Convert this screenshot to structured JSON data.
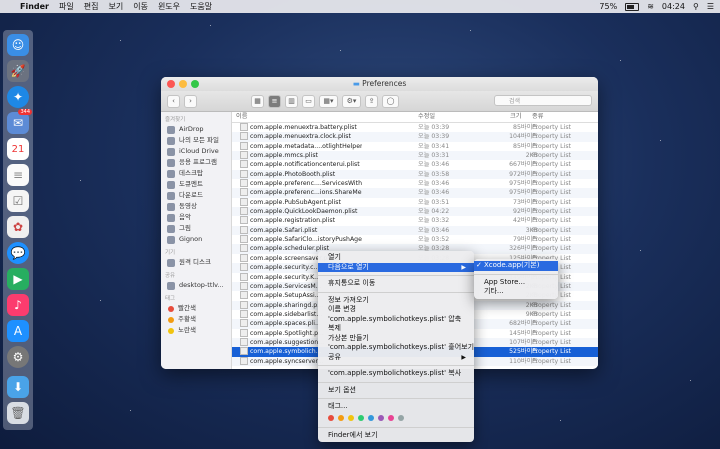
{
  "menubar": {
    "app": "Finder",
    "items": [
      "파일",
      "편집",
      "보기",
      "이동",
      "윈도우",
      "도움말"
    ],
    "battery": "75%",
    "clock": "04:24"
  },
  "window": {
    "title": "Preferences",
    "search_placeholder": "검색"
  },
  "sidebar": {
    "favorites_header": "즐겨찾기",
    "favorites": [
      "AirDrop",
      "나의 모든 파일",
      "iCloud Drive",
      "응용 프로그램",
      "데스크탑",
      "도큐멘트",
      "다운로드",
      "동영상",
      "음악",
      "그림",
      "Gignon"
    ],
    "devices_header": "기기",
    "devices": [
      "원격 디스크"
    ],
    "shared_header": "공유",
    "shared": [
      "desktop-ttlv..."
    ],
    "tags_header": "태그",
    "tags": [
      {
        "label": "빨간색",
        "color": "#e74c3c"
      },
      {
        "label": "주황색",
        "color": "#f39c12"
      },
      {
        "label": "노란색",
        "color": "#f1c40f"
      }
    ]
  },
  "list": {
    "headers": {
      "name": "이름",
      "date": "수정일",
      "size": "크기",
      "kind": "종류"
    },
    "rows": [
      {
        "name": "com.apple.menuextra.battery.plist",
        "date": "오늘 03:39",
        "size": "85바이트",
        "kind": "Property List"
      },
      {
        "name": "com.apple.menuextra.clock.plist",
        "date": "오늘 03:39",
        "size": "104바이트",
        "kind": "Property List"
      },
      {
        "name": "com.apple.metadata....otlightHelper.plist",
        "date": "오늘 03:41",
        "size": "85바이트",
        "kind": "Property List"
      },
      {
        "name": "com.apple.mmcs.plist",
        "date": "오늘 03:31",
        "size": "2KB",
        "kind": "Property List"
      },
      {
        "name": "com.apple.notificationcenterui.plist",
        "date": "오늘 03:46",
        "size": "667바이트",
        "kind": "Property List"
      },
      {
        "name": "com.apple.PhotoBooth.plist",
        "date": "오늘 03:58",
        "size": "972바이트",
        "kind": "Property List"
      },
      {
        "name": "com.apple.preferenc....ServicesWithui.plist",
        "date": "오늘 03:46",
        "size": "975바이트",
        "kind": "Property List"
      },
      {
        "name": "com.apple.preferenc...ions.ShareMenu.plist",
        "date": "오늘 03:46",
        "size": "975바이트",
        "kind": "Property List"
      },
      {
        "name": "com.apple.PubSubAgent.plist",
        "date": "오늘 03:51",
        "size": "73바이트",
        "kind": "Property List"
      },
      {
        "name": "com.apple.QuickLookDaemon.plist",
        "date": "오늘 04:22",
        "size": "92바이트",
        "kind": "Property List"
      },
      {
        "name": "com.apple.registration.plist",
        "date": "오늘 03:32",
        "size": "42바이트",
        "kind": "Property List"
      },
      {
        "name": "com.apple.Safari.plist",
        "date": "오늘 03:46",
        "size": "3KB",
        "kind": "Property List"
      },
      {
        "name": "com.apple.SafariClo...istoryPushAgent.plist",
        "date": "오늘 03:52",
        "size": "79바이트",
        "kind": "Property List"
      },
      {
        "name": "com.apple.scheduler.plist",
        "date": "오늘 03:28",
        "size": "326바이트",
        "kind": "Property List"
      },
      {
        "name": "com.apple.screensaver.plist",
        "date": "오늘 03:28",
        "size": "125바이트",
        "kind": "Property List"
      },
      {
        "name": "com.apple.security.c...",
        "date": "",
        "size": "560바이트",
        "kind": "Property List"
      },
      {
        "name": "com.apple.security.K...",
        "date": "",
        "size": "149바이트",
        "kind": "Property List"
      },
      {
        "name": "com.apple.ServicesM...",
        "date": "",
        "size": "2KB",
        "kind": "Property List"
      },
      {
        "name": "com.apple.SetupAssi...",
        "date": "",
        "size": "2KB",
        "kind": "Property List"
      },
      {
        "name": "com.apple.sharingd.p...",
        "date": "",
        "size": "2KB",
        "kind": "Property List"
      },
      {
        "name": "com.apple.sidebarlist...",
        "date": "",
        "size": "9KB",
        "kind": "Property List"
      },
      {
        "name": "com.apple.spaces.pli...",
        "date": "",
        "size": "682바이트",
        "kind": "Property List"
      },
      {
        "name": "com.apple.Spotlight.p...",
        "date": "",
        "size": "145바이트",
        "kind": "Property List"
      },
      {
        "name": "com.apple.suggestion...",
        "date": "",
        "size": "107바이트",
        "kind": "Property List"
      },
      {
        "name": "com.apple.symbolich...",
        "date": "",
        "size": "525바이트",
        "kind": "Property List",
        "selected": true
      },
      {
        "name": "com.apple.syncserver...",
        "date": "",
        "size": "110바이트",
        "kind": "Property List"
      }
    ]
  },
  "context_menu": {
    "items": [
      {
        "label": "열기"
      },
      {
        "label": "다음으로 열기",
        "submenu": true,
        "highlighted": true
      },
      {
        "sep": true
      },
      {
        "label": "휴지통으로 이동"
      },
      {
        "sep": true
      },
      {
        "label": "정보 가져오기"
      },
      {
        "label": "이름 변경"
      },
      {
        "label": "'com.apple.symbolichotkeys.plist' 압축"
      },
      {
        "label": "복제"
      },
      {
        "label": "가상본 만들기"
      },
      {
        "label": "'com.apple.symbolichotkeys.plist' 훑어보기"
      },
      {
        "label": "공유",
        "submenu": true
      },
      {
        "sep": true
      },
      {
        "label": "'com.apple.symbolichotkeys.plist' 복사"
      },
      {
        "sep": true
      },
      {
        "label": "보기 옵션"
      },
      {
        "sep": true
      },
      {
        "label": "태그..."
      },
      {
        "tags": true
      },
      {
        "sep": true
      },
      {
        "label": "Finder에서 보기"
      }
    ],
    "tag_colors": [
      "#e74c3c",
      "#f39c12",
      "#f1c40f",
      "#2ecc71",
      "#3498db",
      "#9b59b6",
      "#e84393",
      "#95a5a6"
    ]
  },
  "submenu": {
    "items": [
      "Xcode.app(기본)",
      "App Store...",
      "기타..."
    ]
  }
}
